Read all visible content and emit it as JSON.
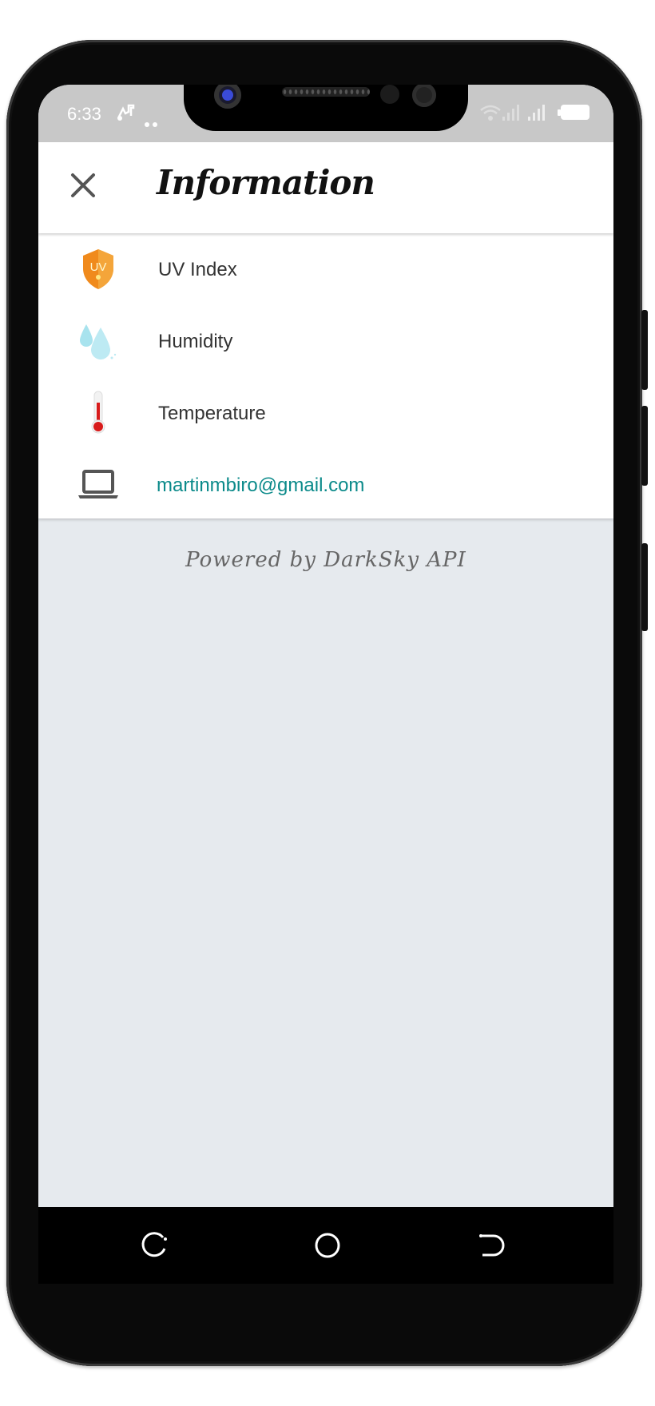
{
  "status": {
    "time": "6:33"
  },
  "header": {
    "title": "Information",
    "close_icon": "close-icon"
  },
  "items": [
    {
      "label": "UV Index",
      "icon": "uv-index-shield-icon"
    },
    {
      "label": "Humidity",
      "icon": "water-drops-icon"
    },
    {
      "label": "Temperature",
      "icon": "thermometer-icon"
    },
    {
      "label": "martinmbiro@gmail.com",
      "icon": "laptop-icon",
      "color": "#0b8a8a"
    }
  ],
  "footer": {
    "powered_by": "Powered by DarkSky API"
  },
  "uv_badge": "UV",
  "colors": {
    "accent": "#0b8a8a",
    "appbar": "#ffffff",
    "background": "#e6eaee",
    "statusbar": "#c8c8c8"
  }
}
